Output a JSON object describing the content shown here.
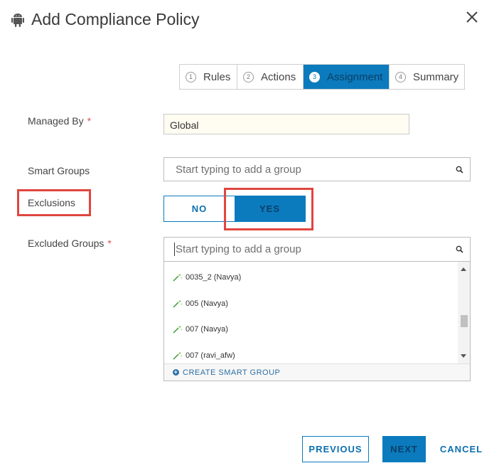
{
  "dialog": {
    "title": "Add Compliance Policy",
    "platform_icon": "android-icon",
    "close_icon": "close-icon"
  },
  "stepper": {
    "steps": [
      {
        "num": "1",
        "label": "Rules"
      },
      {
        "num": "2",
        "label": "Actions"
      },
      {
        "num": "3",
        "label": "Assignment",
        "active": true
      },
      {
        "num": "4",
        "label": "Summary"
      }
    ]
  },
  "form": {
    "managed_by": {
      "label": "Managed By",
      "required": "*",
      "value": "Global"
    },
    "smart_groups": {
      "label": "Smart Groups",
      "placeholder": "Start typing to add a group"
    },
    "exclusions": {
      "label": "Exclusions",
      "no_label": "NO",
      "yes_label": "YES",
      "selected": "YES"
    },
    "excluded_groups": {
      "label": "Excluded Groups",
      "required": "*",
      "placeholder": "Start typing to add a group",
      "results": [
        "0035_2 (Navya)",
        "005 (Navya)",
        "007 (Navya)",
        "007 (ravi_afw)"
      ],
      "create_label": "CREATE SMART GROUP"
    }
  },
  "footer": {
    "previous_label": "PREVIOUS",
    "next_label": "NEXT",
    "cancel_label": "CANCEL"
  },
  "colors": {
    "accent": "#0b7bbd",
    "highlight": "#e0463f",
    "required": "#d9534f"
  }
}
